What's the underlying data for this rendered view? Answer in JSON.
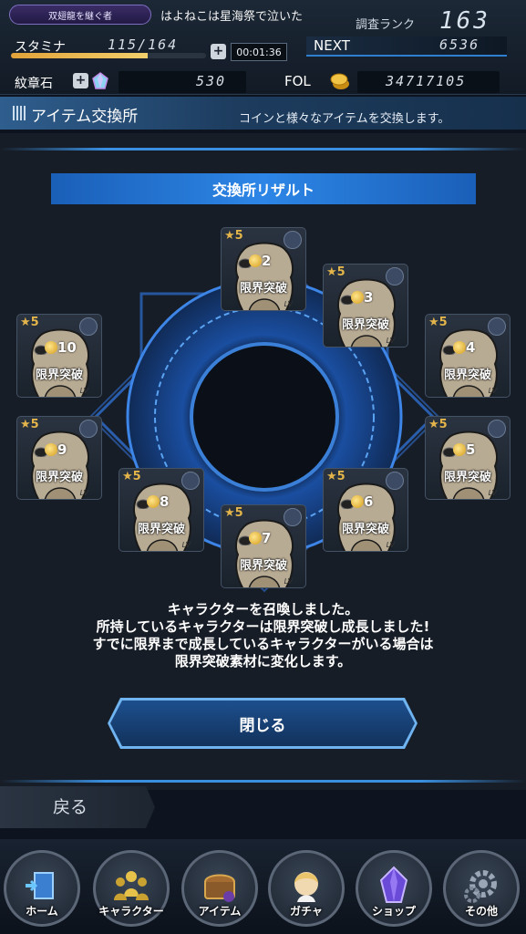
{
  "hud": {
    "title_badge": "双翅龍を継ぐ者",
    "user_name": "はよねこは星海祭で泣いた",
    "rank_label": "調査ランク",
    "rank_value": "163",
    "stamina_label": "スタミナ",
    "stamina_value": "115/164",
    "stamina_progress": 0.7,
    "timer": "00:01:36",
    "next_label": "NEXT",
    "next_value": "6536",
    "stone_label": "紋章石",
    "stone_value": "530",
    "fol_label": "FOL",
    "fol_value": "34717105",
    "plus_symbol": "+"
  },
  "section": {
    "title": "アイテム交換所",
    "description": "コインと様々なアイテムを交換します。"
  },
  "result": {
    "banner": "交換所リザルト",
    "cards": [
      {
        "rarity": "★5",
        "label": "限界突破",
        "number": "10",
        "lv": "LV"
      },
      {
        "rarity": "★5",
        "label": "限界突破",
        "number": "2",
        "lv": "LV"
      },
      {
        "rarity": "★5",
        "label": "限界突破",
        "number": "3",
        "lv": "LV"
      },
      {
        "rarity": "★5",
        "label": "限界突破",
        "number": "4",
        "lv": "LV"
      },
      {
        "rarity": "★5",
        "label": "限界突破",
        "number": "5",
        "lv": "LV"
      },
      {
        "rarity": "★5",
        "label": "限界突破",
        "number": "6",
        "lv": "LV"
      },
      {
        "rarity": "★5",
        "label": "限界突破",
        "number": "7",
        "lv": "LV"
      },
      {
        "rarity": "★5",
        "label": "限界突破",
        "number": "8",
        "lv": "LV"
      },
      {
        "rarity": "★5",
        "label": "限界突破",
        "number": "9",
        "lv": "LV"
      }
    ],
    "message_lines": [
      "キャラクターを召喚しました。",
      "所持しているキャラクターは限界突破し成長しました!",
      "すでに限界まで成長しているキャラクターがいる場合は",
      "限界突破素材に変化します。"
    ],
    "close_label": "閉じる"
  },
  "back_label": "戻る",
  "nav": [
    {
      "label": "ホーム",
      "icon": "home-icon"
    },
    {
      "label": "キャラクター",
      "icon": "characters-icon"
    },
    {
      "label": "アイテム",
      "icon": "item-chest-icon"
    },
    {
      "label": "ガチャ",
      "icon": "gacha-icon"
    },
    {
      "label": "ショップ",
      "icon": "shop-crystal-icon"
    },
    {
      "label": "その他",
      "icon": "gear-icon"
    }
  ],
  "colors": {
    "accent_blue": "#2d86e6",
    "rarity_gold": "#e2b44a",
    "panel_bg": "#171d26"
  }
}
